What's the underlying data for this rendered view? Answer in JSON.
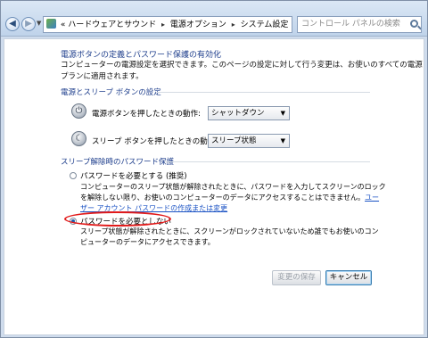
{
  "address": {
    "back_glyph": "◀",
    "forward_glyph": "▶",
    "breadcrumb_prefix": "«",
    "crumbs": [
      "ハードウェアとサウンド",
      "電源オプション",
      "システム設定"
    ],
    "crumb_sep": "▸",
    "search_placeholder": "コントロール パネルの検索"
  },
  "page": {
    "heading": "電源ボタンの定義とパスワード保護の有効化",
    "desc_line1": "コンピューターの電源設定を選択できます。このページの設定に対して行う変更は、お使いのすべての電源",
    "desc_line2": "プランに適用されます。"
  },
  "power_settings": {
    "group_title": "電源とスリープ ボタンの設定",
    "power_label": "電源ボタンを押したときの動作:",
    "power_value": "シャットダウン",
    "sleep_label": "スリープ ボタンを押したときの動作:",
    "sleep_value": "スリープ状態",
    "power_icon_glyph": "⏻",
    "sleep_icon_glyph": "☾"
  },
  "password": {
    "group_title": "スリープ解除時のパスワード保護",
    "opt1_label": "パスワードを必要とする (推奨)",
    "opt1_desc1": "コンピューターのスリープ状態が解除されたときに、パスワードを入力してスクリーンのロック",
    "opt1_desc2": "を解除しない限り、お使いのコンピューターのデータにアクセスすることはできません。",
    "opt1_link1": "ユー",
    "opt1_link2": "ザー アカウント パスワードの作成または変更",
    "opt2_label": "パスワードを必要としない",
    "opt2_desc1": "スリープ状態が解除されたときに、スクリーンがロックされていないため誰でもお使いのコン",
    "opt2_desc2": "ピューターのデータにアクセスできます。"
  },
  "buttons": {
    "save": "変更の保存",
    "cancel": "キャンセル"
  },
  "colors": {
    "heading_blue": "#1e3e8c",
    "highlight_red": "#e21a1a",
    "link_blue": "#1a52c4"
  }
}
